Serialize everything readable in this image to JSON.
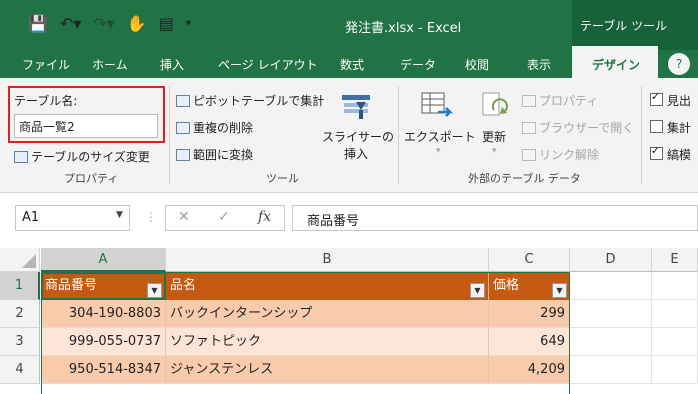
{
  "window": {
    "title": "発注書.xlsx  -  Excel",
    "contextual_tab_group": "テーブル ツール"
  },
  "tabs": [
    {
      "label": "ファイル"
    },
    {
      "label": "ホーム"
    },
    {
      "label": "挿入"
    },
    {
      "label": "ページ レイアウト"
    },
    {
      "label": "数式"
    },
    {
      "label": "データ"
    },
    {
      "label": "校閲"
    },
    {
      "label": "表示"
    },
    {
      "label": "デザイン"
    }
  ],
  "ribbon": {
    "properties": {
      "table_name_label": "テーブル名:",
      "table_name_value": "商品一覧2",
      "resize_label": "テーブルのサイズ変更",
      "group_label": "プロパティ"
    },
    "tools": {
      "pivot_label": "ピボットテーブルで集計",
      "remove_dup_label": "重複の削除",
      "convert_label": "範囲に変換",
      "slicer_label_1": "スライサーの",
      "slicer_label_2": "挿入",
      "group_label": "ツール"
    },
    "external": {
      "export_label": "エクスポート",
      "refresh_label": "更新",
      "properties_label": "プロパティ",
      "browser_label": "ブラウザーで開く",
      "unlink_label": "リンク解除",
      "group_label": "外部のテーブル データ"
    },
    "style_options": {
      "header_row_label": "見出",
      "total_row_label": "集計",
      "banded_label": "縞模",
      "header_row_checked": true,
      "total_row_checked": false,
      "banded_checked": true
    }
  },
  "formula_bar": {
    "name_box": "A1",
    "fx_label": "fx",
    "content": "商品番号"
  },
  "grid": {
    "columns": [
      "A",
      "B",
      "C",
      "D",
      "E"
    ],
    "rows": [
      "1",
      "2",
      "3",
      "4"
    ],
    "table_headers": [
      "商品番号",
      "品名",
      "価格"
    ],
    "table_rows": [
      [
        "304-190-8803",
        "バックインターンシップ",
        "299"
      ],
      [
        "999-055-0737",
        "ソファトピック",
        "649"
      ],
      [
        "950-514-8347",
        "ジャンステンレス",
        "4,209"
      ]
    ]
  },
  "colors": {
    "excel_green": "#217346",
    "table_header": "#c65911",
    "band_dark": "#f8cbad",
    "band_light": "#fce4d6",
    "highlight_red": "#e02020"
  },
  "icons": [
    "save-icon",
    "undo-icon",
    "redo-icon",
    "touch-mode-icon",
    "form-icon",
    "help-icon",
    "filter-dropdown-icon"
  ]
}
